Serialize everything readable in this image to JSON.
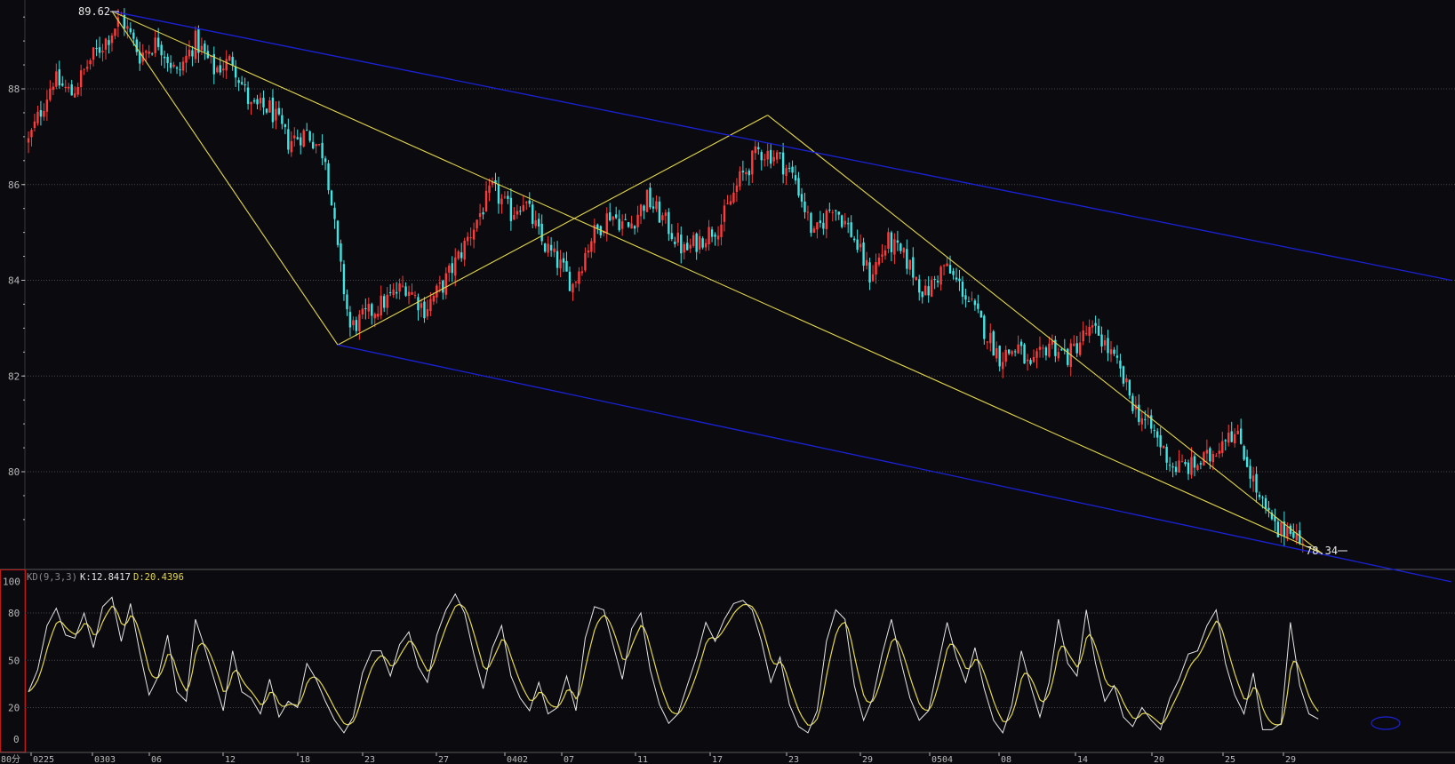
{
  "colors": {
    "background": "#0b0a0e",
    "grid": "#4a4a4a",
    "axis_text": "#b8b8b8",
    "bull": "#ff3b3b",
    "bear": "#3fe6e6",
    "trend_yellow": "#e4d84a",
    "channel_blue": "#1a22d8",
    "k_line": "#e6e6e6",
    "d_line": "#e4d84a",
    "panel_border": "#c01818"
  },
  "price_panel": {
    "y_ticks": [
      "88",
      "86",
      "84",
      "82",
      "80"
    ],
    "high_label": "89.62",
    "low_label": "78.34"
  },
  "indicator_panel": {
    "name": "KD(9,3,3)",
    "k_text": "K:12.8417",
    "d_text": "D:20.4396",
    "y_ticks": [
      "100",
      "80",
      "50",
      "20",
      "0"
    ]
  },
  "period_label": "80分",
  "x_labels": [
    "0225",
    "0303",
    "06",
    "12",
    "18",
    "23",
    "27",
    "0402",
    "07",
    "11",
    "17",
    "23",
    "29",
    "0504",
    "08",
    "14",
    "20",
    "25",
    "29"
  ],
  "chart_data": [
    {
      "type": "candlestick",
      "ylim": [
        78.0,
        90.0
      ],
      "x_labels": [
        "0225",
        "0303",
        "06",
        "12",
        "18",
        "23",
        "27",
        "0402",
        "07",
        "11",
        "17",
        "23",
        "29",
        "0504",
        "08",
        "14",
        "20",
        "25",
        "29"
      ],
      "close_path": [
        {
          "bar": 0,
          "price": 86.9
        },
        {
          "bar": 8,
          "price": 88.2
        },
        {
          "bar": 14,
          "price": 87.9
        },
        {
          "bar": 20,
          "price": 88.6
        },
        {
          "bar": 26,
          "price": 89.1
        },
        {
          "bar": 30,
          "price": 89.5
        },
        {
          "bar": 36,
          "price": 88.7
        },
        {
          "bar": 42,
          "price": 89.0
        },
        {
          "bar": 48,
          "price": 88.3
        },
        {
          "bar": 54,
          "price": 89.0
        },
        {
          "bar": 60,
          "price": 88.4
        },
        {
          "bar": 66,
          "price": 88.6
        },
        {
          "bar": 72,
          "price": 87.6
        },
        {
          "bar": 78,
          "price": 87.6
        },
        {
          "bar": 84,
          "price": 86.9
        },
        {
          "bar": 90,
          "price": 87.1
        },
        {
          "bar": 96,
          "price": 86.6
        },
        {
          "bar": 100,
          "price": 84.6
        },
        {
          "bar": 104,
          "price": 83.0
        },
        {
          "bar": 110,
          "price": 83.3
        },
        {
          "bar": 116,
          "price": 83.6
        },
        {
          "bar": 122,
          "price": 83.9
        },
        {
          "bar": 128,
          "price": 83.4
        },
        {
          "bar": 134,
          "price": 83.9
        },
        {
          "bar": 140,
          "price": 84.6
        },
        {
          "bar": 146,
          "price": 85.4
        },
        {
          "bar": 150,
          "price": 85.9
        },
        {
          "bar": 156,
          "price": 85.4
        },
        {
          "bar": 160,
          "price": 85.7
        },
        {
          "bar": 166,
          "price": 84.8
        },
        {
          "bar": 172,
          "price": 84.3
        },
        {
          "bar": 176,
          "price": 83.9
        },
        {
          "bar": 182,
          "price": 84.9
        },
        {
          "bar": 188,
          "price": 85.4
        },
        {
          "bar": 194,
          "price": 85.1
        },
        {
          "bar": 200,
          "price": 85.7
        },
        {
          "bar": 206,
          "price": 85.2
        },
        {
          "bar": 212,
          "price": 84.6
        },
        {
          "bar": 218,
          "price": 84.9
        },
        {
          "bar": 224,
          "price": 85.2
        },
        {
          "bar": 230,
          "price": 86.1
        },
        {
          "bar": 236,
          "price": 86.7
        },
        {
          "bar": 242,
          "price": 86.6
        },
        {
          "bar": 248,
          "price": 86.1
        },
        {
          "bar": 254,
          "price": 84.9
        },
        {
          "bar": 260,
          "price": 85.6
        },
        {
          "bar": 266,
          "price": 85.0
        },
        {
          "bar": 272,
          "price": 84.1
        },
        {
          "bar": 278,
          "price": 84.8
        },
        {
          "bar": 284,
          "price": 84.4
        },
        {
          "bar": 290,
          "price": 83.7
        },
        {
          "bar": 296,
          "price": 84.3
        },
        {
          "bar": 302,
          "price": 83.8
        },
        {
          "bar": 308,
          "price": 83.1
        },
        {
          "bar": 314,
          "price": 82.4
        },
        {
          "bar": 320,
          "price": 82.6
        },
        {
          "bar": 324,
          "price": 82.1
        },
        {
          "bar": 330,
          "price": 82.7
        },
        {
          "bar": 336,
          "price": 82.4
        },
        {
          "bar": 342,
          "price": 82.9
        },
        {
          "bar": 346,
          "price": 82.9
        },
        {
          "bar": 352,
          "price": 82.2
        },
        {
          "bar": 358,
          "price": 81.3
        },
        {
          "bar": 364,
          "price": 80.8
        },
        {
          "bar": 370,
          "price": 80.1
        },
        {
          "bar": 376,
          "price": 80.1
        },
        {
          "bar": 382,
          "price": 80.3
        },
        {
          "bar": 388,
          "price": 80.9
        },
        {
          "bar": 392,
          "price": 80.6
        },
        {
          "bar": 398,
          "price": 79.4
        },
        {
          "bar": 404,
          "price": 78.7
        },
        {
          "bar": 408,
          "price": 78.9
        },
        {
          "bar": 412,
          "price": 78.4
        }
      ],
      "yellow_lines": [
        {
          "from": {
            "bar": 27,
            "price": 89.62
          },
          "to": {
            "bar": 100,
            "price": 82.65
          }
        },
        {
          "from": {
            "bar": 27,
            "price": 89.62
          },
          "to": {
            "bar": 418,
            "price": 78.3
          }
        },
        {
          "from": {
            "bar": 100,
            "price": 82.65
          },
          "to": {
            "bar": 239,
            "price": 87.45
          }
        },
        {
          "from": {
            "bar": 239,
            "price": 87.45
          },
          "to": {
            "bar": 418,
            "price": 78.3
          }
        }
      ],
      "blue_channel": [
        {
          "from": {
            "bar": 27,
            "price": 89.62
          },
          "to": {
            "bar": 460,
            "price": 84.0
          }
        },
        {
          "from": {
            "bar": 100,
            "price": 82.65
          },
          "to": {
            "bar": 460,
            "price": 77.7
          }
        }
      ]
    },
    {
      "type": "line",
      "title": "KD(9,3,3)",
      "ylim": [
        0,
        100
      ],
      "series": [
        {
          "name": "K",
          "last": 12.8417
        },
        {
          "name": "D",
          "last": 20.4396
        }
      ],
      "k_path": [
        {
          "bar": 0,
          "v": 30
        },
        {
          "bar": 3,
          "v": 44
        },
        {
          "bar": 6,
          "v": 72
        },
        {
          "bar": 9,
          "v": 83
        },
        {
          "bar": 12,
          "v": 66
        },
        {
          "bar": 15,
          "v": 64
        },
        {
          "bar": 18,
          "v": 80
        },
        {
          "bar": 21,
          "v": 58
        },
        {
          "bar": 24,
          "v": 84
        },
        {
          "bar": 27,
          "v": 90
        },
        {
          "bar": 30,
          "v": 62
        },
        {
          "bar": 33,
          "v": 86
        },
        {
          "bar": 36,
          "v": 55
        },
        {
          "bar": 39,
          "v": 28
        },
        {
          "bar": 42,
          "v": 40
        },
        {
          "bar": 45,
          "v": 66
        },
        {
          "bar": 48,
          "v": 30
        },
        {
          "bar": 51,
          "v": 24
        },
        {
          "bar": 54,
          "v": 76
        },
        {
          "bar": 57,
          "v": 58
        },
        {
          "bar": 60,
          "v": 38
        },
        {
          "bar": 63,
          "v": 18
        },
        {
          "bar": 66,
          "v": 56
        },
        {
          "bar": 69,
          "v": 30
        },
        {
          "bar": 72,
          "v": 26
        },
        {
          "bar": 75,
          "v": 16
        },
        {
          "bar": 78,
          "v": 38
        },
        {
          "bar": 81,
          "v": 14
        },
        {
          "bar": 84,
          "v": 24
        },
        {
          "bar": 87,
          "v": 20
        },
        {
          "bar": 90,
          "v": 48
        },
        {
          "bar": 93,
          "v": 38
        },
        {
          "bar": 96,
          "v": 24
        },
        {
          "bar": 99,
          "v": 12
        },
        {
          "bar": 102,
          "v": 4
        },
        {
          "bar": 105,
          "v": 14
        },
        {
          "bar": 108,
          "v": 42
        },
        {
          "bar": 111,
          "v": 56
        },
        {
          "bar": 114,
          "v": 56
        },
        {
          "bar": 117,
          "v": 40
        },
        {
          "bar": 120,
          "v": 60
        },
        {
          "bar": 123,
          "v": 68
        },
        {
          "bar": 126,
          "v": 46
        },
        {
          "bar": 129,
          "v": 36
        },
        {
          "bar": 132,
          "v": 66
        },
        {
          "bar": 135,
          "v": 82
        },
        {
          "bar": 138,
          "v": 92
        },
        {
          "bar": 141,
          "v": 80
        },
        {
          "bar": 144,
          "v": 54
        },
        {
          "bar": 147,
          "v": 32
        },
        {
          "bar": 150,
          "v": 58
        },
        {
          "bar": 153,
          "v": 72
        },
        {
          "bar": 156,
          "v": 40
        },
        {
          "bar": 159,
          "v": 26
        },
        {
          "bar": 162,
          "v": 18
        },
        {
          "bar": 165,
          "v": 36
        },
        {
          "bar": 168,
          "v": 16
        },
        {
          "bar": 171,
          "v": 20
        },
        {
          "bar": 174,
          "v": 40
        },
        {
          "bar": 177,
          "v": 18
        },
        {
          "bar": 180,
          "v": 64
        },
        {
          "bar": 183,
          "v": 84
        },
        {
          "bar": 186,
          "v": 82
        },
        {
          "bar": 189,
          "v": 60
        },
        {
          "bar": 192,
          "v": 38
        },
        {
          "bar": 195,
          "v": 70
        },
        {
          "bar": 198,
          "v": 80
        },
        {
          "bar": 201,
          "v": 44
        },
        {
          "bar": 204,
          "v": 22
        },
        {
          "bar": 207,
          "v": 10
        },
        {
          "bar": 210,
          "v": 16
        },
        {
          "bar": 213,
          "v": 34
        },
        {
          "bar": 216,
          "v": 52
        },
        {
          "bar": 219,
          "v": 74
        },
        {
          "bar": 222,
          "v": 62
        },
        {
          "bar": 225,
          "v": 76
        },
        {
          "bar": 228,
          "v": 86
        },
        {
          "bar": 231,
          "v": 88
        },
        {
          "bar": 234,
          "v": 82
        },
        {
          "bar": 237,
          "v": 62
        },
        {
          "bar": 240,
          "v": 36
        },
        {
          "bar": 243,
          "v": 52
        },
        {
          "bar": 246,
          "v": 22
        },
        {
          "bar": 249,
          "v": 8
        },
        {
          "bar": 252,
          "v": 4
        },
        {
          "bar": 255,
          "v": 18
        },
        {
          "bar": 258,
          "v": 62
        },
        {
          "bar": 261,
          "v": 82
        },
        {
          "bar": 264,
          "v": 76
        },
        {
          "bar": 267,
          "v": 34
        },
        {
          "bar": 270,
          "v": 12
        },
        {
          "bar": 273,
          "v": 26
        },
        {
          "bar": 276,
          "v": 54
        },
        {
          "bar": 279,
          "v": 76
        },
        {
          "bar": 282,
          "v": 50
        },
        {
          "bar": 285,
          "v": 26
        },
        {
          "bar": 288,
          "v": 12
        },
        {
          "bar": 291,
          "v": 18
        },
        {
          "bar": 294,
          "v": 46
        },
        {
          "bar": 297,
          "v": 74
        },
        {
          "bar": 300,
          "v": 52
        },
        {
          "bar": 303,
          "v": 36
        },
        {
          "bar": 306,
          "v": 58
        },
        {
          "bar": 309,
          "v": 32
        },
        {
          "bar": 312,
          "v": 12
        },
        {
          "bar": 315,
          "v": 4
        },
        {
          "bar": 318,
          "v": 22
        },
        {
          "bar": 321,
          "v": 56
        },
        {
          "bar": 324,
          "v": 34
        },
        {
          "bar": 327,
          "v": 14
        },
        {
          "bar": 330,
          "v": 36
        },
        {
          "bar": 333,
          "v": 76
        },
        {
          "bar": 336,
          "v": 48
        },
        {
          "bar": 339,
          "v": 40
        },
        {
          "bar": 342,
          "v": 82
        },
        {
          "bar": 345,
          "v": 48
        },
        {
          "bar": 348,
          "v": 24
        },
        {
          "bar": 351,
          "v": 34
        },
        {
          "bar": 354,
          "v": 14
        },
        {
          "bar": 357,
          "v": 8
        },
        {
          "bar": 360,
          "v": 20
        },
        {
          "bar": 363,
          "v": 12
        },
        {
          "bar": 366,
          "v": 6
        },
        {
          "bar": 369,
          "v": 26
        },
        {
          "bar": 372,
          "v": 38
        },
        {
          "bar": 375,
          "v": 54
        },
        {
          "bar": 378,
          "v": 56
        },
        {
          "bar": 381,
          "v": 72
        },
        {
          "bar": 384,
          "v": 82
        },
        {
          "bar": 387,
          "v": 48
        },
        {
          "bar": 390,
          "v": 28
        },
        {
          "bar": 393,
          "v": 16
        },
        {
          "bar": 396,
          "v": 42
        },
        {
          "bar": 399,
          "v": 6
        },
        {
          "bar": 402,
          "v": 6
        },
        {
          "bar": 405,
          "v": 10
        },
        {
          "bar": 408,
          "v": 74
        },
        {
          "bar": 411,
          "v": 34
        },
        {
          "bar": 414,
          "v": 16
        },
        {
          "bar": 417,
          "v": 12.8
        }
      ]
    }
  ]
}
